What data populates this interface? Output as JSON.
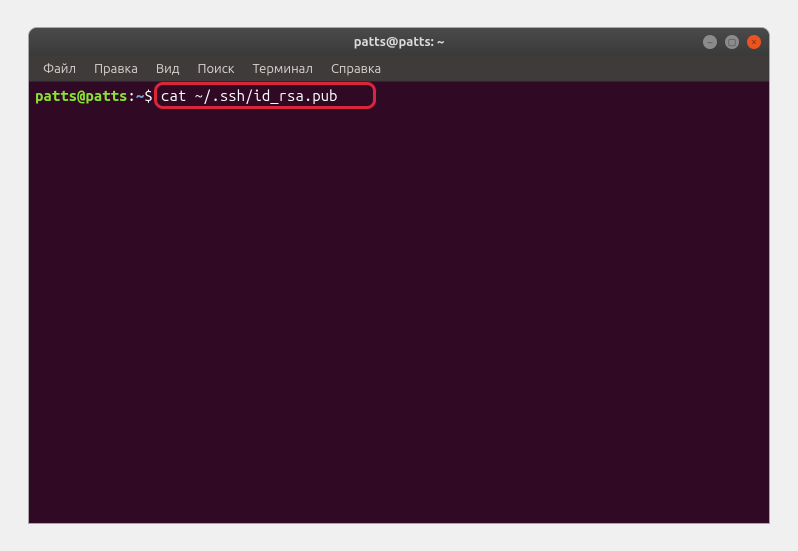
{
  "window": {
    "title": "patts@patts: ~"
  },
  "menubar": {
    "items": [
      {
        "label": "Файл"
      },
      {
        "label": "Правка"
      },
      {
        "label": "Вид"
      },
      {
        "label": "Поиск"
      },
      {
        "label": "Терминал"
      },
      {
        "label": "Справка"
      }
    ]
  },
  "terminal": {
    "prompt": {
      "user_host": "patts@patts",
      "colon": ":",
      "path": "~",
      "symbol": "$"
    },
    "command": " cat ~/.ssh/id_rsa.pub"
  },
  "icons": {
    "minimize": "–",
    "maximize": "▢",
    "close": "×"
  }
}
